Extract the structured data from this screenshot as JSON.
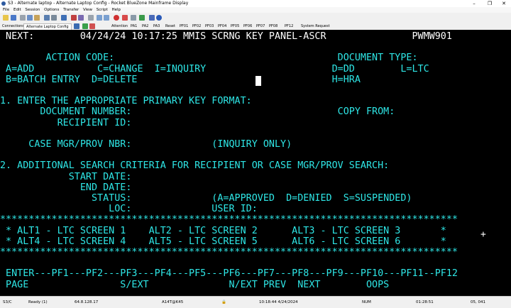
{
  "window": {
    "title": "S3 - Alternate laptop - Alternate Laptop Config - Rocket BlueZone Mainframe Display",
    "minimize": "–",
    "maximize": "❐",
    "close": "✕"
  },
  "menu": [
    "File",
    "Edit",
    "Session",
    "Options",
    "Transfer",
    "View",
    "Script",
    "Help"
  ],
  "macrobar": {
    "connections_label": "Connections",
    "session_tab": "Alternate Laptop Config",
    "keys": [
      "Attention",
      "PA1",
      "PA2",
      "PA3",
      "Reset",
      "PF01",
      "PF02",
      "PF03",
      "PF04",
      "PF05",
      "PF06",
      "PF07",
      "PF08",
      "PF12",
      "System Request"
    ]
  },
  "screen": {
    "lines": [
      {
        "segments": [
          {
            "t": " NEXT:        04/24/24 10:17:25 MMIS SCRNG KEY PANEL-ASCR               PWMW901",
            "c": "white"
          }
        ]
      },
      {
        "segments": [
          {
            "t": "",
            "c": "cyan"
          }
        ]
      },
      {
        "segments": [
          {
            "t": "        ACTION CODE:                                       DOCUMENT TYPE:",
            "c": "cyan"
          }
        ]
      },
      {
        "segments": [
          {
            "t": " A=ADD           C=CHANGE  I=INQUIRY                      D=DD        L=LTC",
            "c": "cyan"
          }
        ]
      },
      {
        "segments": [
          {
            "t": " B=BATCH ENTRY  D=DELETE                                  H=HRA",
            "c": "cyan"
          }
        ]
      },
      {
        "segments": [
          {
            "t": "",
            "c": "cyan"
          }
        ]
      },
      {
        "segments": [
          {
            "t": "1. ENTER THE APPROPRIATE PRIMARY KEY FORMAT:",
            "c": "cyan"
          }
        ]
      },
      {
        "segments": [
          {
            "t": "       DOCUMENT NUMBER:                                    COPY FROM:",
            "c": "cyan"
          }
        ]
      },
      {
        "segments": [
          {
            "t": "          RECIPIENT ID:",
            "c": "cyan"
          }
        ]
      },
      {
        "segments": [
          {
            "t": "",
            "c": "cyan"
          }
        ]
      },
      {
        "segments": [
          {
            "t": "     CASE MGR/PROV NBR:              (INQUIRY ONLY)",
            "c": "cyan"
          }
        ]
      },
      {
        "segments": [
          {
            "t": "",
            "c": "cyan"
          }
        ]
      },
      {
        "segments": [
          {
            "t": "2. ADDITIONAL SEARCH CRITERIA FOR RECIPIENT OR CASE MGR/PROV SEARCH:",
            "c": "cyan"
          }
        ]
      },
      {
        "segments": [
          {
            "t": "            START DATE:",
            "c": "cyan"
          }
        ]
      },
      {
        "segments": [
          {
            "t": "              END DATE:",
            "c": "cyan"
          }
        ]
      },
      {
        "segments": [
          {
            "t": "                STATUS:              (A=APPROVED  D=DENIED  S=SUSPENDED)",
            "c": "cyan"
          }
        ]
      },
      {
        "segments": [
          {
            "t": "                   LOC:              USER ID:",
            "c": "cyan"
          }
        ]
      },
      {
        "segments": [
          {
            "t": "********************************************************************************",
            "c": "cyan"
          }
        ]
      },
      {
        "segments": [
          {
            "t": " * ALT1 - LTC SCREEN 1    ALT2 - LTC SCREEN 2      ALT3 - LTC SCREEN 3       *",
            "c": "cyan"
          }
        ]
      },
      {
        "segments": [
          {
            "t": " * ALT4 - LTC SCREEN 4    ALT5 - LTC SCREEN 5      ALT6 - LTC SCREEN 6       *",
            "c": "cyan"
          }
        ]
      },
      {
        "segments": [
          {
            "t": "********************************************************************************",
            "c": "cyan"
          }
        ]
      },
      {
        "segments": [
          {
            "t": "",
            "c": "cyan"
          }
        ]
      },
      {
        "segments": [
          {
            "t": " ENTER---PF1---PF2---PF3---PF4---PF5---PF6---PF7---PF8---PF9---PF10---PF11--PF12",
            "c": "cyan"
          }
        ]
      },
      {
        "segments": [
          {
            "t": " PAGE                S/EXT              N/EXT PREV  NEXT        OOPS",
            "c": "cyan"
          }
        ]
      }
    ],
    "pointer_glyph": "+"
  },
  "status": {
    "session": "S3/C",
    "state": "Ready (1)",
    "host": "64.8.128.17",
    "terminal": "A14T@K45",
    "lock": "🔒",
    "datetime": "10:18:44  4/24/2024",
    "numlock": "NUM",
    "elapsed": "01:28:51",
    "cursor_pos": "05, 041"
  },
  "colors": {
    "screen_bg": "#000000",
    "field_text": "#2ee6e6",
    "header_text": "#ffffff"
  }
}
